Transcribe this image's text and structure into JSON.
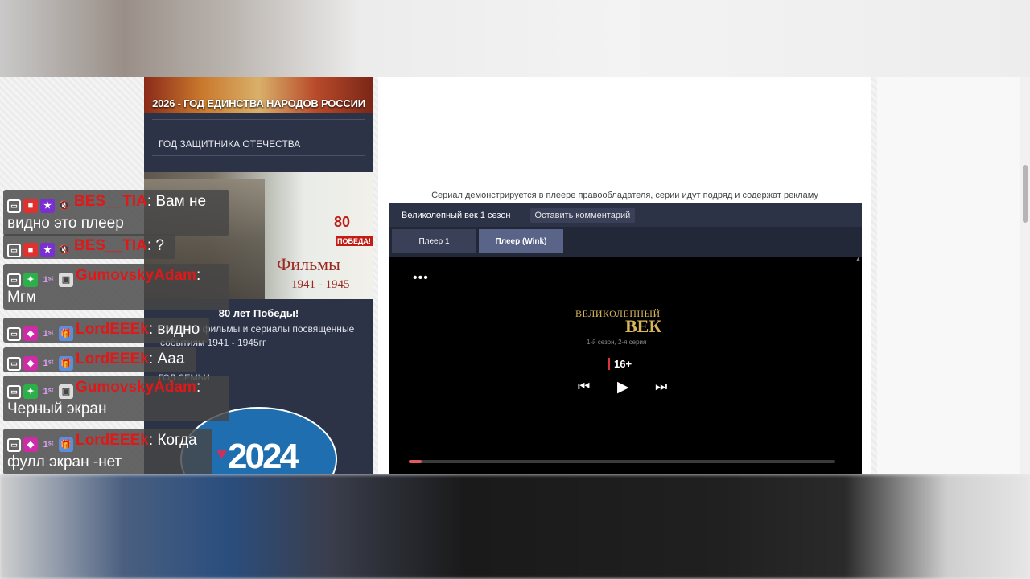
{
  "sidebar": {
    "banner_2026": "2026 - ГОД ЕДИНСТВА НАРОДОВ РОССИИ",
    "heading_defender": "ГОД ЗАЩИТНИКА ОТЕЧЕСТВА",
    "films_banner": {
      "title": "Фильмы",
      "years": "1941 - 1945",
      "pobeda_number": "80",
      "pobeda_word": "ПОБЕДА!"
    },
    "victory_title": "80 лет Победы!",
    "victory_text": "Собрали фильмы и сериалы посвященные событиям 1941 - 1945гг",
    "heading_family": "ГОД СЕМЬИ",
    "year_badge": "2024"
  },
  "main": {
    "notice": "Сериал демонстрируется в плеере правообладателя, серии идут подряд и содержат рекламу",
    "player": {
      "title": "Великолепный век 1 сезон",
      "comment_link": "Оставить комментарий",
      "tabs": [
        {
          "label": "Плеер 1",
          "active": false
        },
        {
          "label": "Плеер (Wink)",
          "active": true
        }
      ],
      "menu_dots": "•••",
      "show_logo_top": "ВЕЛИКОЛЕПНЫЙ",
      "show_logo_main": "ВЕК",
      "show_episode": "1-й сезон, 2-я серия",
      "age_rating": "16+",
      "progress_fraction": 0.03
    }
  },
  "chat": {
    "messages": [
      {
        "badges": [
          "twitch",
          "cam",
          "star",
          "mute"
        ],
        "user": "BES__TIA",
        "text": ": Вам не видно это плеер"
      },
      {
        "badges": [
          "twitch",
          "cam",
          "star",
          "mute"
        ],
        "user": "BES__TIA",
        "text": ": ?"
      },
      {
        "badges": [
          "twitch",
          "green",
          "first",
          "grey"
        ],
        "user": "GumovskyAdam",
        "text": ": Мгм"
      },
      {
        "badges": [
          "twitch",
          "pink",
          "first",
          "gift"
        ],
        "user": "LordEEEk",
        "text": ": видно"
      },
      {
        "badges": [
          "twitch",
          "pink",
          "first",
          "gift"
        ],
        "user": "LordEEEk",
        "text": ": Ааа"
      },
      {
        "badges": [
          "twitch",
          "green",
          "first",
          "grey"
        ],
        "user": "GumovskyAdam",
        "text": ": Черный экран"
      },
      {
        "badges": [
          "twitch",
          "pink",
          "first",
          "gift"
        ],
        "user": "LordEEEk",
        "text": ": Когда фулл экран -нет"
      }
    ]
  },
  "colors": {
    "sidebar_bg": "#2d3347",
    "player_header": "#2d3347",
    "active_tab": "#5a6488",
    "chat_username": "#e01818",
    "logo_gold": "#d8b45a"
  }
}
